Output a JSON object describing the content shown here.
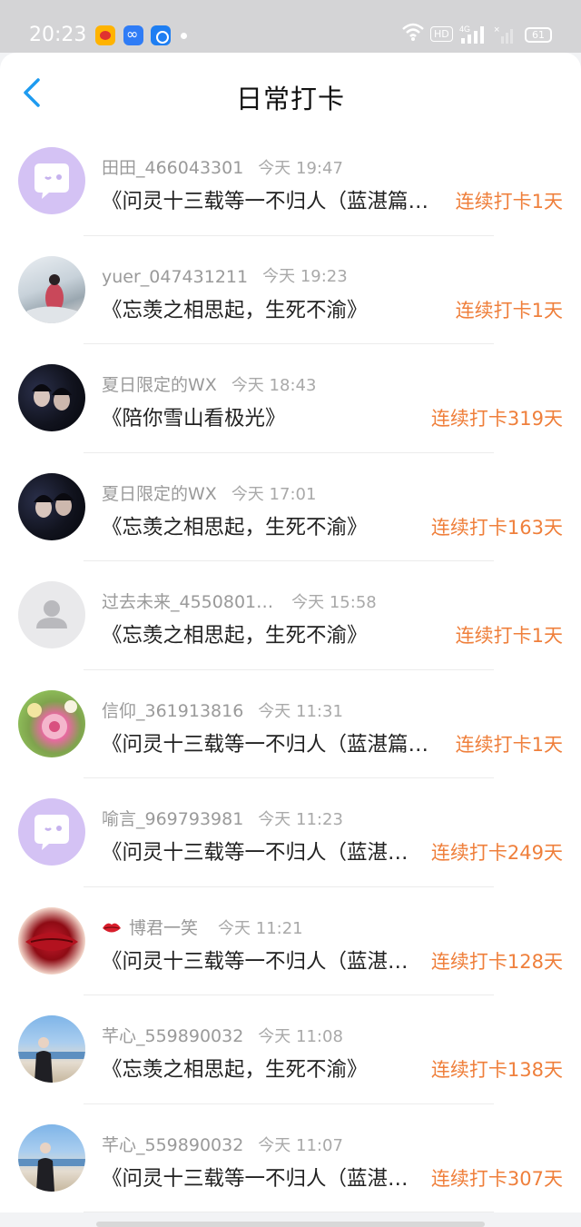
{
  "status_bar": {
    "time": "20:23",
    "hd_label": "HD",
    "network": "4G",
    "battery": "61"
  },
  "header": {
    "title": "日常打卡"
  },
  "colors": {
    "accent": "#ef7f3b",
    "back": "#1e9bf0"
  },
  "checkins": [
    {
      "user": "田田_466043301",
      "time": "今天 19:47",
      "content": "《问灵十三载等一不归人（蓝湛篇…",
      "streak": "连续打卡1天",
      "avatar": "chat-bubble-icon"
    },
    {
      "user": "yuer_047431211",
      "time": "今天 19:23",
      "content": "《忘羡之相思起，生死不渝》",
      "streak": "连续打卡1天",
      "avatar": "photo"
    },
    {
      "user": "夏日限定的WX",
      "time": "今天 18:43",
      "content": "《陪你雪山看极光》",
      "streak": "连续打卡319天",
      "avatar": "photo"
    },
    {
      "user": "夏日限定的WX",
      "time": "今天 17:01",
      "content": "《忘羡之相思起，生死不渝》",
      "streak": "连续打卡163天",
      "avatar": "photo"
    },
    {
      "user": "过去未来_4550801…",
      "time": "今天 15:58",
      "content": "《忘羡之相思起，生死不渝》",
      "streak": "连续打卡1天",
      "avatar": "default-user-icon"
    },
    {
      "user": "信仰_361913816",
      "time": "今天 11:31",
      "content": "《问灵十三载等一不归人（蓝湛篇…",
      "streak": "连续打卡1天",
      "avatar": "photo"
    },
    {
      "user": "喻言_969793981",
      "time": "今天 11:23",
      "content": "《问灵十三载等一不归人（蓝湛…",
      "streak": "连续打卡249天",
      "avatar": "chat-bubble-icon"
    },
    {
      "user": "博君一笑",
      "time": "今天 11:21",
      "content": "《问灵十三载等一不归人（蓝湛…",
      "streak": "连续打卡128天",
      "avatar": "photo",
      "badge": "lips-icon"
    },
    {
      "user": "芊心_559890032",
      "time": "今天 11:08",
      "content": "《忘羡之相思起，生死不渝》",
      "streak": "连续打卡138天",
      "avatar": "photo"
    },
    {
      "user": "芊心_559890032",
      "time": "今天 11:07",
      "content": "《问灵十三载等一不归人（蓝湛…",
      "streak": "连续打卡307天",
      "avatar": "photo"
    }
  ]
}
